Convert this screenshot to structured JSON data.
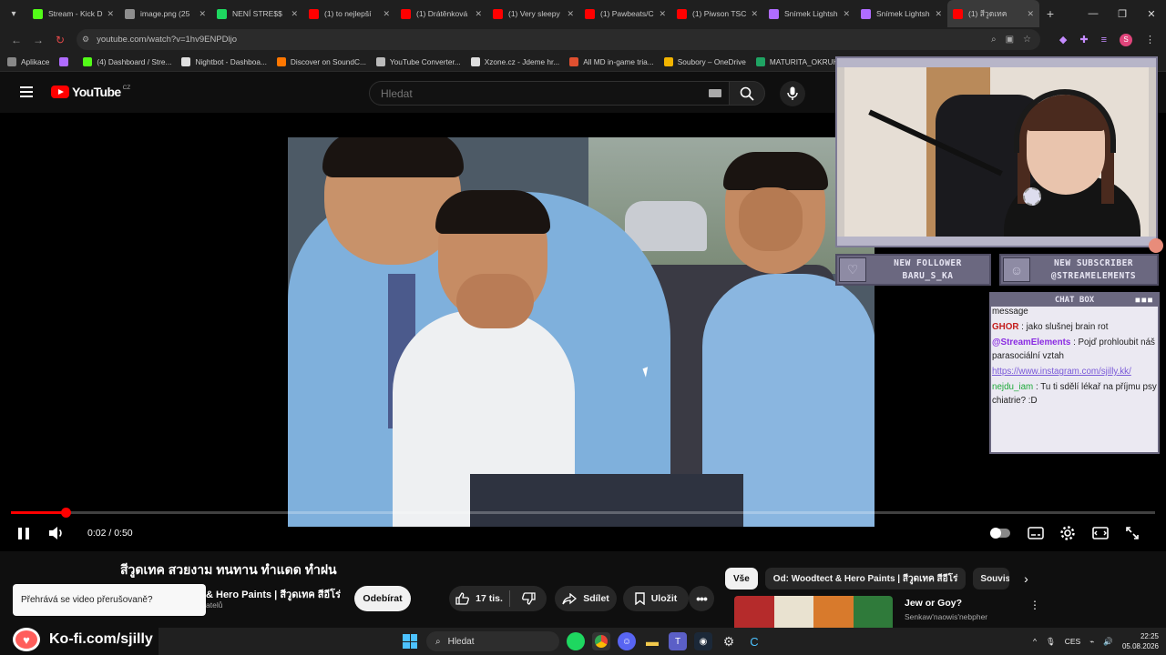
{
  "browser": {
    "tabs": [
      {
        "title": "Stream - Kick D",
        "color": "#53fc18",
        "active": false
      },
      {
        "title": "image.png (25",
        "color": "#8e8e8e",
        "active": false
      },
      {
        "title": "NENÍ STRE$$",
        "color": "#1ed760",
        "active": false
      },
      {
        "title": "(1) to nejlepší",
        "color": "#ff0000",
        "active": false
      },
      {
        "title": "(1) Drátěnková",
        "color": "#ff0000",
        "active": false
      },
      {
        "title": "(1) Very sleepy",
        "color": "#ff0000",
        "active": false
      },
      {
        "title": "(1) Pawbeats/C",
        "color": "#ff0000",
        "active": false
      },
      {
        "title": "(1) Piwson TSC",
        "color": "#ff0000",
        "active": false
      },
      {
        "title": "Snímek Lightsh",
        "color": "#b06cff",
        "active": false
      },
      {
        "title": "Snímek Lightsh",
        "color": "#b06cff",
        "active": false
      },
      {
        "title": "(1) สีวูดเทค",
        "color": "#ff0000",
        "active": true
      }
    ],
    "url": "youtube.com/watch?v=1hv9ENPDljo",
    "bookmarks": [
      {
        "label": "Aplikace",
        "color": "#888"
      },
      {
        "label": "",
        "color": "#b06cff"
      },
      {
        "label": "(4) Dashboard / Stre...",
        "color": "#53fc18"
      },
      {
        "label": "Nightbot - Dashboa...",
        "color": "#e0e0e0"
      },
      {
        "label": "Discover on SoundC...",
        "color": "#ff7700"
      },
      {
        "label": "YouTube Converter...",
        "color": "#bbb"
      },
      {
        "label": "Xzone.cz - Jdeme hr...",
        "color": "#ddd"
      },
      {
        "label": "All MD in-game tria...",
        "color": "#e05030"
      },
      {
        "label": "Soubory – OneDrive",
        "color": "#f2b400"
      },
      {
        "label": "MATURITA_OKRUH...",
        "color": "#1fa463"
      }
    ]
  },
  "youtube": {
    "logo_text": "YouTube",
    "country": "CZ",
    "search_placeholder": "Hledat",
    "player": {
      "time": "0:02 / 0:50",
      "progress": 0.048
    },
    "video_title": "สีวูดเทค สวยงาม ทนทาน ทำแดด ทำฝน",
    "channel_name": "& Hero Paints | สีวูดเทค สีอีโร่",
    "channel_subs": "atelů",
    "subscribe_label": "Odebírat",
    "like_count": "17 tis.",
    "share_label": "Sdílet",
    "save_label": "Uložit",
    "chips": [
      "Vše",
      "Od: Woodtect & Hero Paints | สีวูดเทค สีอีโร่",
      "Souvisejí"
    ],
    "recommendation": {
      "title": "Jew or Goy?",
      "channel": "Senkaw'naowis'nebpher"
    },
    "toast": "Přehrává se video přerušovaně?"
  },
  "overlay": {
    "follower_title": "NEW FOLLOWER",
    "follower_name": "BARU_S_KA",
    "subscriber_title": "NEW SUBSCRIBER",
    "subscriber_name": "@STREAMELEMENTS",
    "chat_title": "CHAT BOX",
    "chat": [
      {
        "user": "",
        "text": "message",
        "user_class": ""
      },
      {
        "user": "GHOR",
        "text": " : jako slušnej brain rot",
        "user_class": "u-red"
      },
      {
        "user": "@StreamElements",
        "text": " : Pojď prohloubit náš parasociální vztah",
        "user_class": "u-purple"
      },
      {
        "user": "",
        "text": "https://www.instagram.com/sjilly.kk/",
        "user_class": "link"
      },
      {
        "user": "nejdu_iam",
        "text": " : Tu ti sdělí lékař na příjmu psychiatrie? :D",
        "user_class": "u-green"
      }
    ],
    "kofi": "Ko-fi.com/sjilly"
  },
  "taskbar": {
    "search": "Hledat",
    "lang": "CES",
    "time": "22:25",
    "date": "05.08.2026"
  }
}
